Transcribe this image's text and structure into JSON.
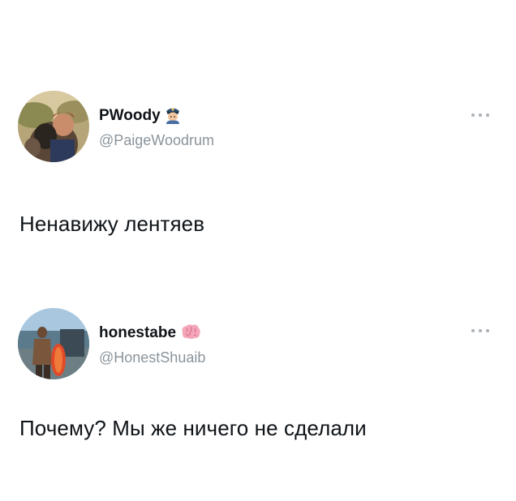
{
  "tweets": [
    {
      "display_name": "PWoody",
      "handle": "@PaigeWoodrum",
      "badge_emoji": "police-officer-emoji",
      "text": "Ненавижу лентяев"
    },
    {
      "display_name": "honestabe",
      "handle": "@HonestShuaib",
      "badge_emoji": "brain-emoji",
      "text": "Почему? Мы же ничего не сделали"
    }
  ],
  "colors": {
    "background": "#ffffff",
    "text": "#0f1419",
    "handle": "#8a949c",
    "more_dots": "#aab0b6"
  }
}
